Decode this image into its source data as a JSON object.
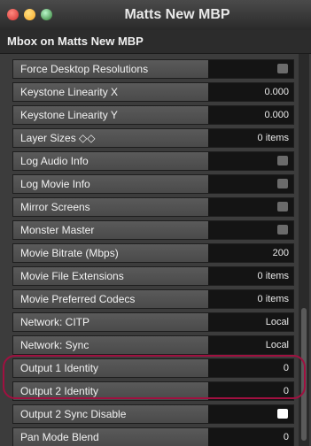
{
  "window": {
    "title": "Matts New MBP",
    "subtitle": "Mbox on Matts New MBP"
  },
  "settings": [
    {
      "label": "Force Desktop Resolutions",
      "kind": "checkbox",
      "checked": false
    },
    {
      "label": "Keystone Linearity X",
      "value": "0.000"
    },
    {
      "label": "Keystone Linearity Y",
      "value": "0.000"
    },
    {
      "label": "Layer Sizes ◇◇",
      "value": "0 items"
    },
    {
      "label": "Log Audio Info",
      "kind": "checkbox",
      "checked": false
    },
    {
      "label": "Log Movie Info",
      "kind": "checkbox",
      "checked": false
    },
    {
      "label": "Mirror Screens",
      "kind": "checkbox",
      "checked": false
    },
    {
      "label": "Monster Master",
      "kind": "checkbox",
      "checked": false
    },
    {
      "label": "Movie Bitrate (Mbps)",
      "value": "200"
    },
    {
      "label": "Movie File Extensions",
      "value": "0 items"
    },
    {
      "label": "Movie Preferred Codecs",
      "value": "0 items"
    },
    {
      "label": "Network: CITP",
      "value": "Local"
    },
    {
      "label": "Network: Sync",
      "value": "Local"
    },
    {
      "label": "Output 1 Identity",
      "value": "0"
    },
    {
      "label": "Output 2 Identity",
      "value": "0"
    },
    {
      "label": "Output 2 Sync Disable",
      "kind": "checkbox",
      "checked": true
    },
    {
      "label": "Pan Mode Blend",
      "value": "0"
    }
  ]
}
